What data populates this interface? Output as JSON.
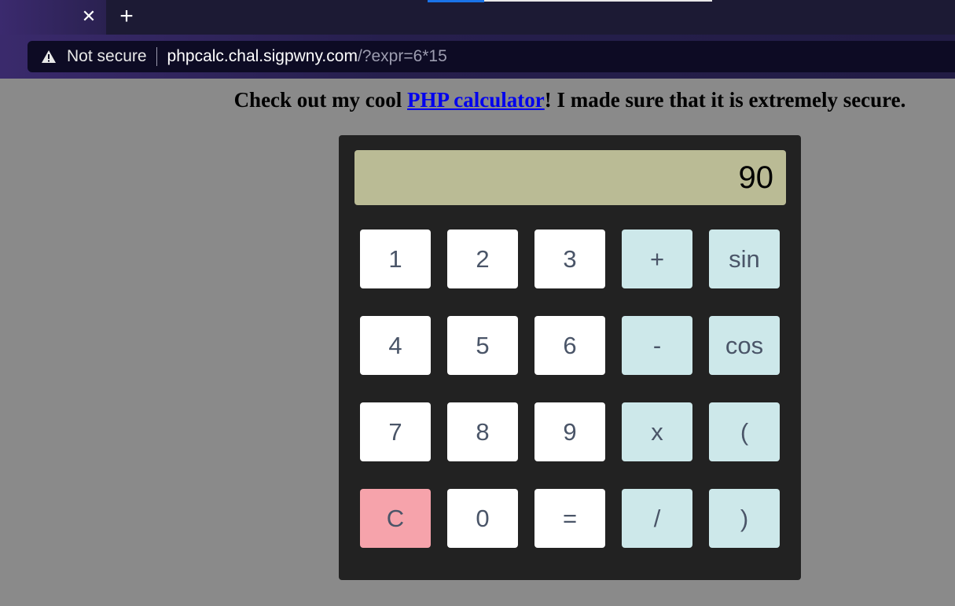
{
  "browser": {
    "tab_close_icon": "close-icon",
    "new_tab_icon": "plus-icon",
    "security_label": "Not secure",
    "url_host": "phpcalc.chal.sigpwny.com",
    "url_path": "/?expr=6*15",
    "tab_close_glyph": "✕",
    "new_tab_glyph": "+"
  },
  "page": {
    "intro_before": "Check out my cool ",
    "intro_link": "PHP calculator",
    "intro_after": "! I made sure that it is extremely secure."
  },
  "calculator": {
    "display_value": "90",
    "keys": [
      {
        "label": "1",
        "kind": "num"
      },
      {
        "label": "2",
        "kind": "num"
      },
      {
        "label": "3",
        "kind": "num"
      },
      {
        "label": "+",
        "kind": "op"
      },
      {
        "label": "sin",
        "kind": "op"
      },
      {
        "label": "4",
        "kind": "num"
      },
      {
        "label": "5",
        "kind": "num"
      },
      {
        "label": "6",
        "kind": "num"
      },
      {
        "label": "-",
        "kind": "op"
      },
      {
        "label": "cos",
        "kind": "op"
      },
      {
        "label": "7",
        "kind": "num"
      },
      {
        "label": "8",
        "kind": "num"
      },
      {
        "label": "9",
        "kind": "num"
      },
      {
        "label": "x",
        "kind": "op"
      },
      {
        "label": "(",
        "kind": "op"
      },
      {
        "label": "C",
        "kind": "clear"
      },
      {
        "label": "0",
        "kind": "num"
      },
      {
        "label": "=",
        "kind": "num"
      },
      {
        "label": "/",
        "kind": "op"
      },
      {
        "label": ")",
        "kind": "op"
      }
    ]
  },
  "colors": {
    "page_background": "#8a8a8a",
    "calculator_body": "#222222",
    "display_background": "#babb95",
    "number_key": "#ffffff",
    "operator_key": "#cde8ea",
    "clear_key": "#f6a3ab",
    "link": "#0000ee"
  }
}
